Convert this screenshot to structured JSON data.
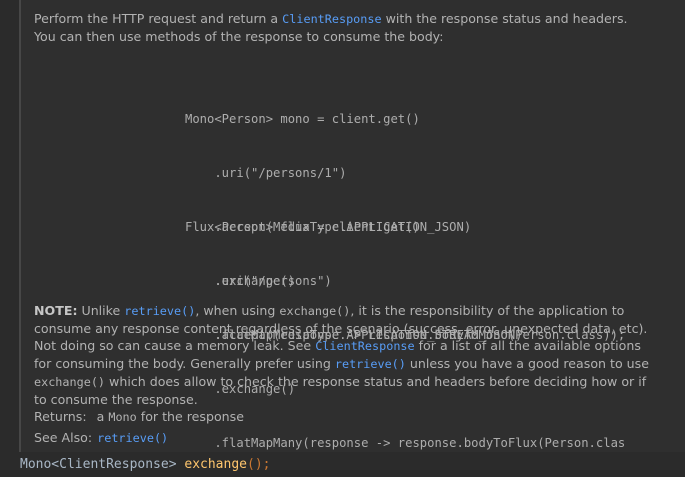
{
  "doc": {
    "intro": {
      "t1": "Perform the HTTP request and return a ",
      "c1": "ClientResponse",
      "t2": " with the response status and headers.",
      "t3": "You can then use methods of the response to consume the body:"
    },
    "code_examples": [
      {
        "lines": [
          "Mono<Person> mono = client.get()",
          "    .uri(\"/persons/1\")",
          "    .accept(MediaType.APPLICATION_JSON)",
          "    .exchange()",
          "    .flatMap(response -> response.bodyToMono(Person.class));"
        ]
      },
      {
        "lines": [
          "Flux<Person> flux = client.get()",
          "    .uri(\"/persons\")",
          "    .accept(MediaType.APPLICATION_STREAM_JSON)",
          "    .exchange()",
          "    .flatMapMany(response -> response.bodyToFlux(Person.class));"
        ]
      }
    ],
    "note": {
      "label": "NOTE:",
      "t1": " Unlike ",
      "c1": "retrieve()",
      "t2": ", when using ",
      "c2": "exchange()",
      "t3": ", it is the responsibility of the application to consume any response content regardless of the scenario (success, error, unexpected data, etc). Not doing so can cause a memory leak. See ",
      "c3": "ClientResponse",
      "t4": " for a list of all the available options for consuming the body. Generally prefer using ",
      "c4": "retrieve()",
      "t5": " unless you have a good reason to use ",
      "c5": "exchange()",
      "t6": " which does allow to check the response status and headers before deciding how or if to consume the response."
    },
    "returns": {
      "label": "Returns:",
      "t1": "a ",
      "c1": "Mono",
      "t2": " for the response"
    },
    "see_also": {
      "label": "See Also:",
      "link": "retrieve()"
    }
  },
  "signature": {
    "type": "Mono<ClientResponse>",
    "method": "exchange",
    "punct": "();"
  },
  "colors": {
    "background": "#2b2b2b",
    "doc_background": "#2f2f2f",
    "text": "#b2b2b2",
    "link": "#589df6",
    "method_name": "#ffc66d",
    "keyword_punct": "#cc7832"
  }
}
